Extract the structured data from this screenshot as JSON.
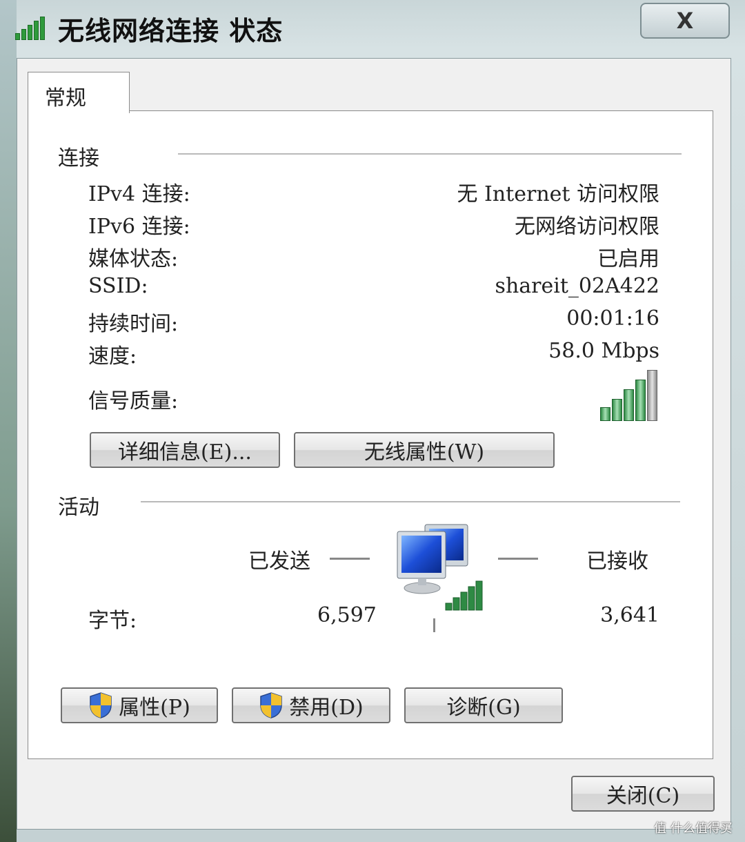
{
  "window": {
    "title": "无线网络连接 状态",
    "close_glyph": "X",
    "close_icon": "close-icon",
    "title_icon": "wireless-signal-icon"
  },
  "tabs": [
    {
      "label": "常规",
      "selected": true
    }
  ],
  "connection": {
    "group_label": "连接",
    "rows": [
      {
        "label": "IPv4 连接:",
        "value": "无 Internet 访问权限"
      },
      {
        "label": "IPv6 连接:",
        "value": "无网络访问权限"
      },
      {
        "label": "媒体状态:",
        "value": "已启用"
      },
      {
        "label": "SSID:",
        "value": "shareit_02A422"
      },
      {
        "label": "持续时间:",
        "value": "00:01:16"
      },
      {
        "label": "速度:",
        "value": "58.0 Mbps"
      }
    ],
    "signal_label": "信号质量:",
    "signal_bars_active": 4,
    "signal_bars_total": 5,
    "details_button": "详细信息(E)...",
    "wireless_props_button": "无线属性(W)"
  },
  "activity": {
    "group_label": "活动",
    "sent_label": "已发送",
    "received_label": "已接收",
    "bytes_label": "字节:",
    "bytes_sent": "6,597",
    "bytes_received": "3,641",
    "network_icon": "network-computers-icon"
  },
  "buttons": {
    "properties": "属性(P)",
    "disable": "禁用(D)",
    "diagnose": "诊断(G)",
    "close": "关闭(C)"
  },
  "watermark": "值 什么值得买",
  "colors": {
    "signal_green": "#2e8a44",
    "title_bar": "#c9d6d8",
    "panel_bg": "#ffffff"
  }
}
